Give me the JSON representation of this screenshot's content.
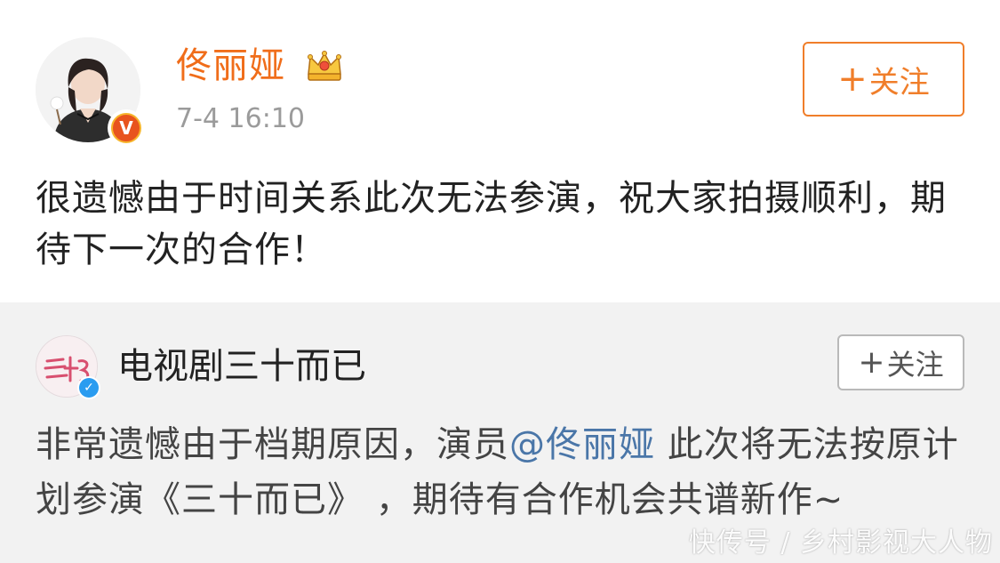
{
  "post": {
    "user_name": "佟丽娅",
    "timestamp": "7-4 16:10",
    "follow_label": "关注",
    "content": "很遗憾由于时间关系此次无法参演，祝大家拍摄顺利，期待下一次的合作！",
    "badge_text": "V",
    "colors": {
      "name": "#f06d1a",
      "follow_border": "#f07e2a",
      "badge": "#e8541e"
    }
  },
  "repost": {
    "user_name": "电视剧三十而已",
    "follow_label": "关注",
    "content_before": "非常遗憾由于档期原因，演员",
    "mention": "@佟丽娅",
    "content_after": " 此次将无法按原计划参演《三十而已》 ，期待有合作机会共谱新作~",
    "colors": {
      "mention": "#4a76a8",
      "background": "#f2f2f2",
      "badge": "#2a9cf0"
    }
  },
  "watermark": "快传号 / 乡村影视大人物",
  "icons": {
    "crown": "crown-icon",
    "verified_orange": "verified-badge-icon",
    "verified_blue": "verified-badge-icon",
    "plus": "plus-icon"
  }
}
